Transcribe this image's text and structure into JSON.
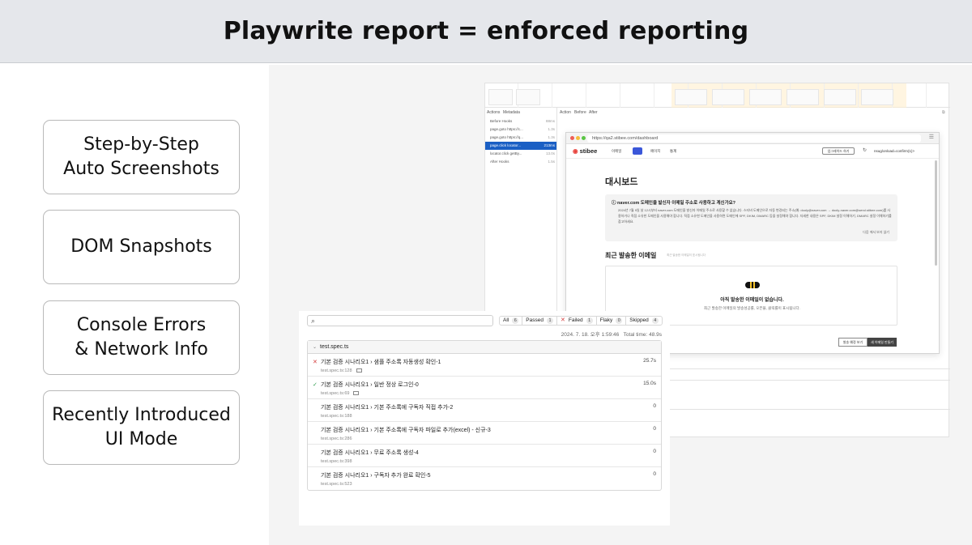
{
  "slide": {
    "title": "Playwrite report = enforced reporting",
    "features": [
      "Step-by-Step\nAuto Screenshots",
      "DOM Snapshots",
      "Console Errors\n& Network Info",
      "Recently Introduced\nUI Mode"
    ]
  },
  "trace": {
    "tabs": {
      "actions": "Actions",
      "metadata": "Metadata",
      "action": "Action",
      "before": "Before",
      "after": "After"
    },
    "actions": [
      {
        "label": "Before Hooks",
        "duration": "88ms"
      },
      {
        "label": "page.goto https://c...",
        "duration": "1.3s"
      },
      {
        "label": "page.goto https://q...",
        "duration": "1.3s"
      },
      {
        "label": "page.click locator...",
        "duration": "213ms"
      },
      {
        "label": "locator.click getBy...",
        "duration": "13.0s"
      },
      {
        "label": "After Hooks",
        "duration": "1.5s"
      }
    ]
  },
  "snapshot": {
    "url": "https://qa2.stibee.com/dashboard",
    "logo": "stibee",
    "nav": [
      "이메일",
      "페이지",
      "통계"
    ],
    "upgrade_label": "업그레이드 하기",
    "account": "nsug/onload=confirm(1)>",
    "dashboard_title": "대시보드",
    "notice_title": "naver.com 도메인을 발신자 이메일 주소로 사용하고 계신가요?",
    "notice_body": "2024년 7월 9일 날 12시부터 naver.com 도메인을 발신자 이메일 주소로 사용할 수 없습니다. 스티비 도메인으로 자동 변경되는 주소(예: dooly@naver.com → dooly-naver.com@send.stibee.com)를 사용하거나 직접 소유한 도메인을 사용해야 합니다. 직접 소유한 도메인을 사용하면 도메인에 SPF, DKIM, DMARC 등을 설정해야 합니다. 자세한 내용은 SPF, DKIM 설정 이해하기, DMARC 설정 이해하기를 참고하세요.",
    "notice_link": "다음 에서 보지 않기",
    "recent_title": "최근 발송한 이메일",
    "recent_subtitle": "최근 발송한 이메일이 표시됩니다",
    "empty_title": "아직 발송한 이메일이 없습니다.",
    "empty_subtitle": "최근 발송한 이메일의 발송성공률, 오픈율, 클릭률이 표시됩니다.",
    "button_a": "발송 예정 보기",
    "button_b": "새 이메일 만들기"
  },
  "report": {
    "search_placeholder": "",
    "filters": [
      {
        "label": "All",
        "count": "6"
      },
      {
        "label": "Passed",
        "count": "1"
      },
      {
        "label": "Failed",
        "count": "1"
      },
      {
        "label": "Flaky",
        "count": "0"
      },
      {
        "label": "Skipped",
        "count": "4"
      }
    ],
    "run_time": "2024. 7. 18. 오후 1:59:46",
    "total_time": "Total time: 48.9s",
    "suite": "test.spec.ts",
    "tests": [
      {
        "status": "failed",
        "icon": "✕",
        "name": "기본 검증 시나리오1 › 샘플 주소록 자동생성 확인-1",
        "location": "test.spec.ts:128",
        "duration": "25.7s",
        "has_image": true
      },
      {
        "status": "passed",
        "icon": "✓",
        "name": "기본 검증 시나리오1 › 일반 정상 로그인-0",
        "location": "test.spec.ts:69",
        "duration": "15.0s",
        "has_image": true
      },
      {
        "status": "skipped",
        "icon": "",
        "name": "기본 검증 시나리오1 › 기본 주소록에 구독자 직접 추가-2",
        "location": "test.spec.ts:188",
        "duration": "0",
        "has_image": false
      },
      {
        "status": "skipped",
        "icon": "",
        "name": "기본 검증 시나리오1 › 기본 주소록에 구독자 파일로 추가(excel) - 신규-3",
        "location": "test.spec.ts:286",
        "duration": "0",
        "has_image": false
      },
      {
        "status": "skipped",
        "icon": "",
        "name": "기본 검증 시나리오1 › 무료 주소록 생성-4",
        "location": "test.spec.ts:398",
        "duration": "0",
        "has_image": false
      },
      {
        "status": "skipped",
        "icon": "",
        "name": "기본 검증 시나리오1 › 구독자 추가 완료 확인-5",
        "location": "test.spec.ts:523",
        "duration": "0",
        "has_image": false
      }
    ]
  }
}
